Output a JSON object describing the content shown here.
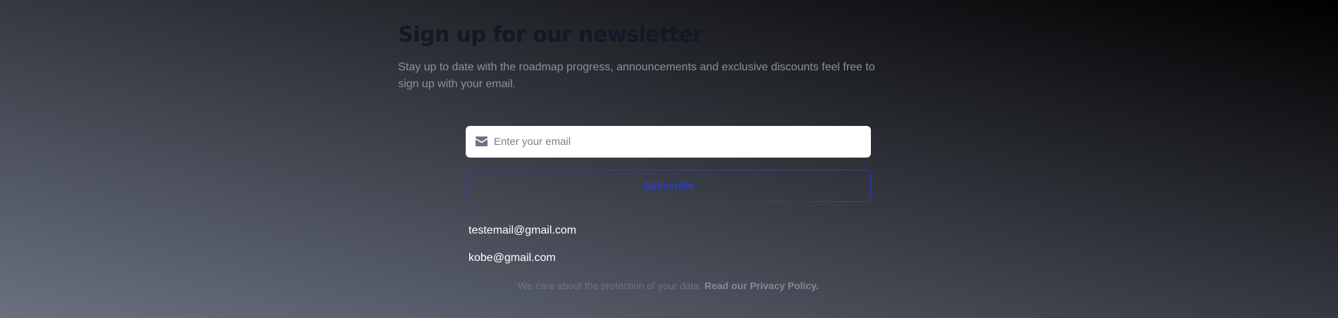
{
  "newsletter": {
    "title": "Sign up for our newsletter",
    "subtitle": "Stay up to date with the roadmap progress, announcements and exclusive discounts feel free to sign up with your email."
  },
  "form": {
    "email_icon": "mail-icon",
    "email_placeholder": "Enter your email",
    "email_value": "",
    "subscribe_label": "Subscribe"
  },
  "subscribers": [
    "testemail@gmail.com",
    "kobe@gmail.com"
  ],
  "privacy": {
    "text": "We care about the protection of your data.",
    "link_label": "Read our Privacy Policy."
  },
  "colors": {
    "accent": "#2d3ec4",
    "title": "#121826"
  }
}
